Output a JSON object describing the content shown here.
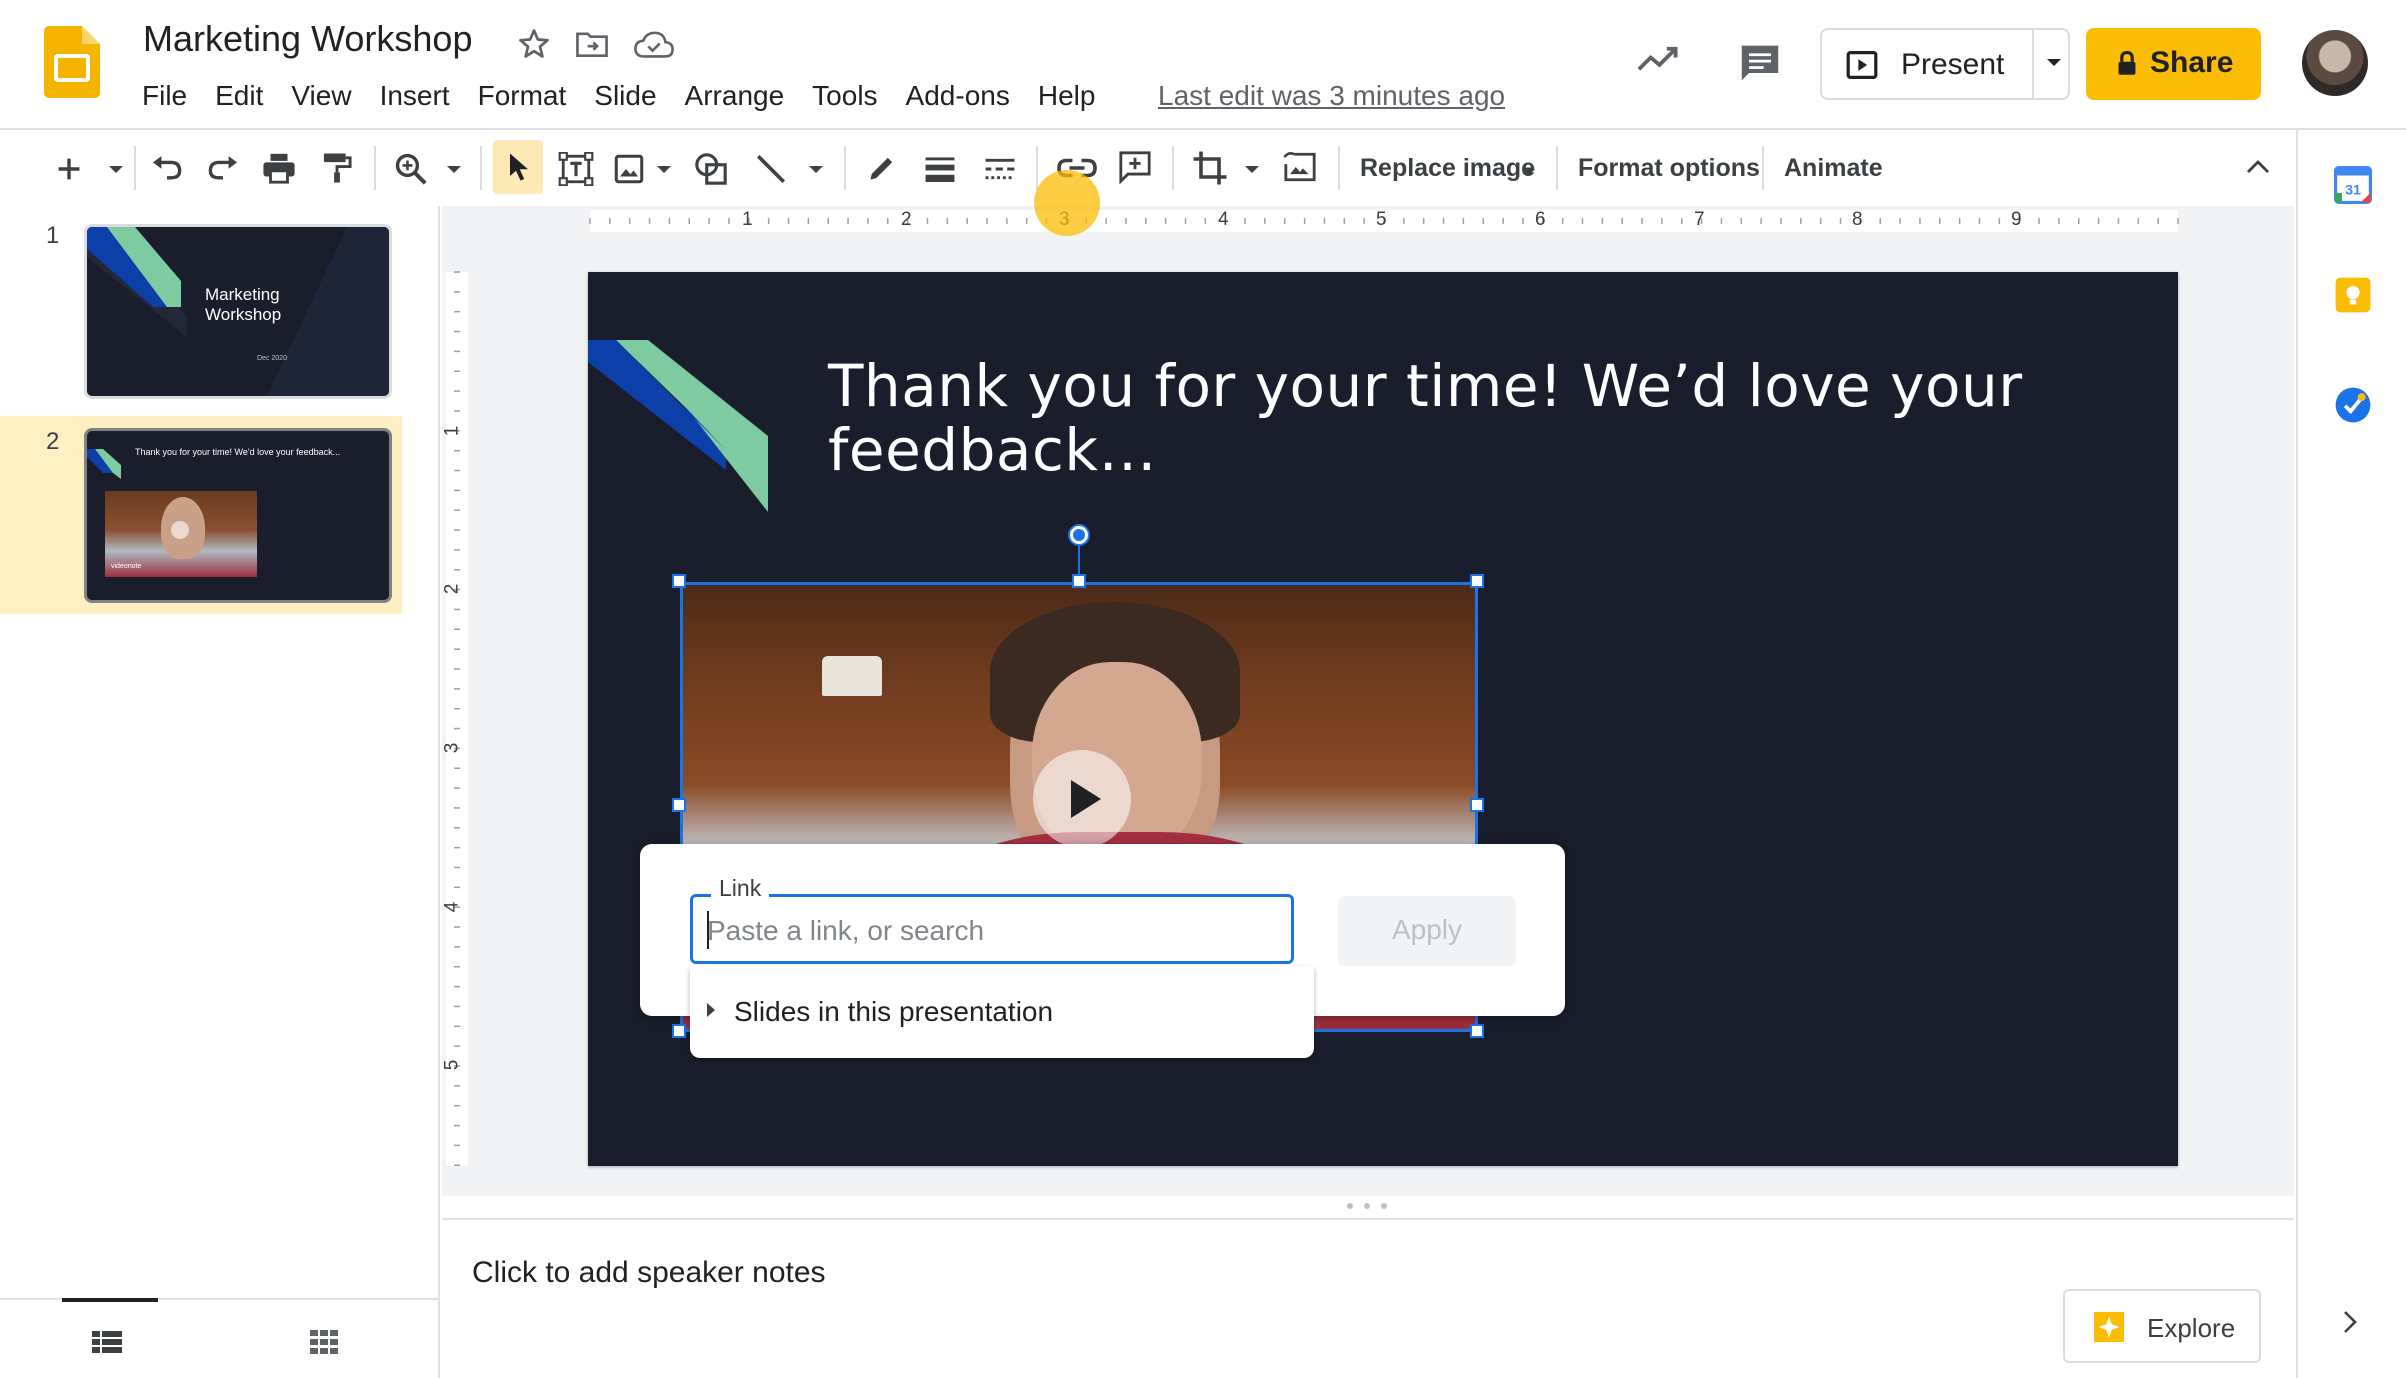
{
  "header": {
    "doc_title": "Marketing Workshop",
    "menu": [
      "File",
      "Edit",
      "View",
      "Insert",
      "Format",
      "Slide",
      "Arrange",
      "Tools",
      "Add-ons",
      "Help"
    ],
    "last_edit": "Last edit was 3 minutes ago",
    "present_label": "Present",
    "share_label": "Share"
  },
  "toolbar": {
    "replace_image": "Replace image",
    "format_options": "Format options",
    "animate": "Animate"
  },
  "ruler": {
    "h_labels": [
      "1",
      "2",
      "3",
      "4",
      "5",
      "6",
      "7",
      "8",
      "9"
    ],
    "v_labels": [
      "1",
      "2",
      "3",
      "4",
      "5"
    ]
  },
  "filmstrip": {
    "slides": [
      {
        "number": "1",
        "title": "Marketing Workshop",
        "date": "Dec 2020"
      },
      {
        "number": "2",
        "title": "Thank you for your time! We'd love your feedback...",
        "badge": "videonote"
      }
    ]
  },
  "slide": {
    "title": "Thank you for your time! We’d love your feedback…"
  },
  "link_dialog": {
    "label": "Link",
    "placeholder": "Paste a link, or search",
    "apply": "Apply",
    "suggestion": "Slides in this presentation"
  },
  "notes": {
    "placeholder": "Click to add speaker notes"
  },
  "explore": {
    "label": "Explore"
  },
  "colors": {
    "accent": "#1a73e8",
    "share": "#fbbc04",
    "slide_bg": "#1a1e2c",
    "stripe_blue": "#0d3fa8",
    "stripe_green": "#7ecba1"
  }
}
